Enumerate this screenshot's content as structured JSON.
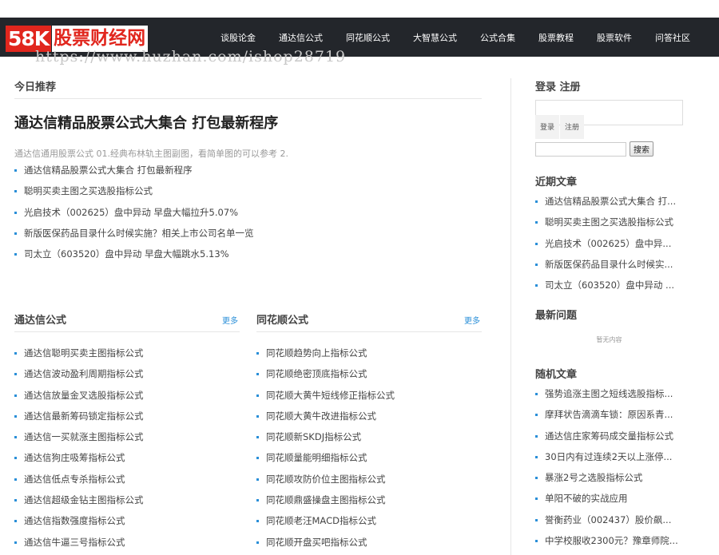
{
  "site": {
    "logo_badge": "58K",
    "logo_name": "股票财经网",
    "watermark": "https://www.huzhan.com/ishop28719"
  },
  "nav": [
    "谈股论金",
    "通达信公式",
    "同花顺公式",
    "大智慧公式",
    "公式合集",
    "股票教程",
    "股票软件",
    "问答社区"
  ],
  "today": {
    "title": "今日推荐",
    "headline": "通达信精品股票公式大集合 打包最新程序",
    "excerpt": "通达信通用股票公式 01.经典布林轨主图副图，看简单图的可以参考 2.",
    "items": [
      "通达信精品股票公式大集合 打包最新程序",
      "聪明买卖主图之买选股指标公式",
      "光启技术（002625）盘中异动 早盘大幅拉升5.07%",
      "新版医保药品目录什么时候实施？相关上市公司名单一览",
      "司太立（603520）盘中异动 早盘大幅跳水5.13%"
    ]
  },
  "tdx": {
    "title": "通达信公式",
    "more": "更多",
    "items": [
      "通达信聪明买卖主图指标公式",
      "通达信波动盈利周期指标公式",
      "通达信放量金叉选股指标公式",
      "通达信最新筹码锁定指标公式",
      "通达信一买就涨主图指标公式",
      "通达信狗庄吸筹指标公式",
      "通达信低点专杀指标公式",
      "通达信超级金钻主图指标公式",
      "通达信指数强度指标公式",
      "通达信牛逼三号指标公式"
    ]
  },
  "ths": {
    "title": "同花顺公式",
    "more": "更多",
    "items": [
      "同花顺趋势向上指标公式",
      "同花顺绝密顶底指标公式",
      "同花顺大黄牛短线修正指标公式",
      "同花顺大黄牛改进指标公式",
      "同花顺新SKDJ指标公式",
      "同花顺量能明细指标公式",
      "同花顺攻防价位主图指标公式",
      "同花顺鼎盛操盘主图指标公式",
      "同花顺老汪MACD指标公式",
      "同花顺开盘买吧指标公式"
    ]
  },
  "sidebar": {
    "login_title": "登录 注册",
    "login_btn": "登录",
    "register_btn": "注册",
    "search_btn": "搜索",
    "recent_title": "近期文章",
    "recent": [
      "通达信精品股票公式大集合 打...",
      "聪明买卖主图之买选股指标公式",
      "光启技术（002625）盘中异...",
      "新版医保药品目录什么时候实...",
      "司太立（603520）盘中异动 ..."
    ],
    "questions_title": "最新问题",
    "questions_empty": "暂无内容",
    "random_title": "随机文章",
    "random": [
      "强势追涨主图之短线选股指标...",
      "摩拜状告滴滴车锁：原因系青...",
      "通达信庄家筹码成交量指标公式",
      "30日内有过连续2天以上涨停...",
      "暴涨2号之选股指标公式",
      "单阳不破的实战应用",
      "誉衡药业（002437）股价飙...",
      "中学校服收2300元？豫章师院..."
    ]
  },
  "colors": {
    "nav_bg": "#23262b",
    "accent": "#e1261d",
    "bullet": "#2a8fd8"
  }
}
